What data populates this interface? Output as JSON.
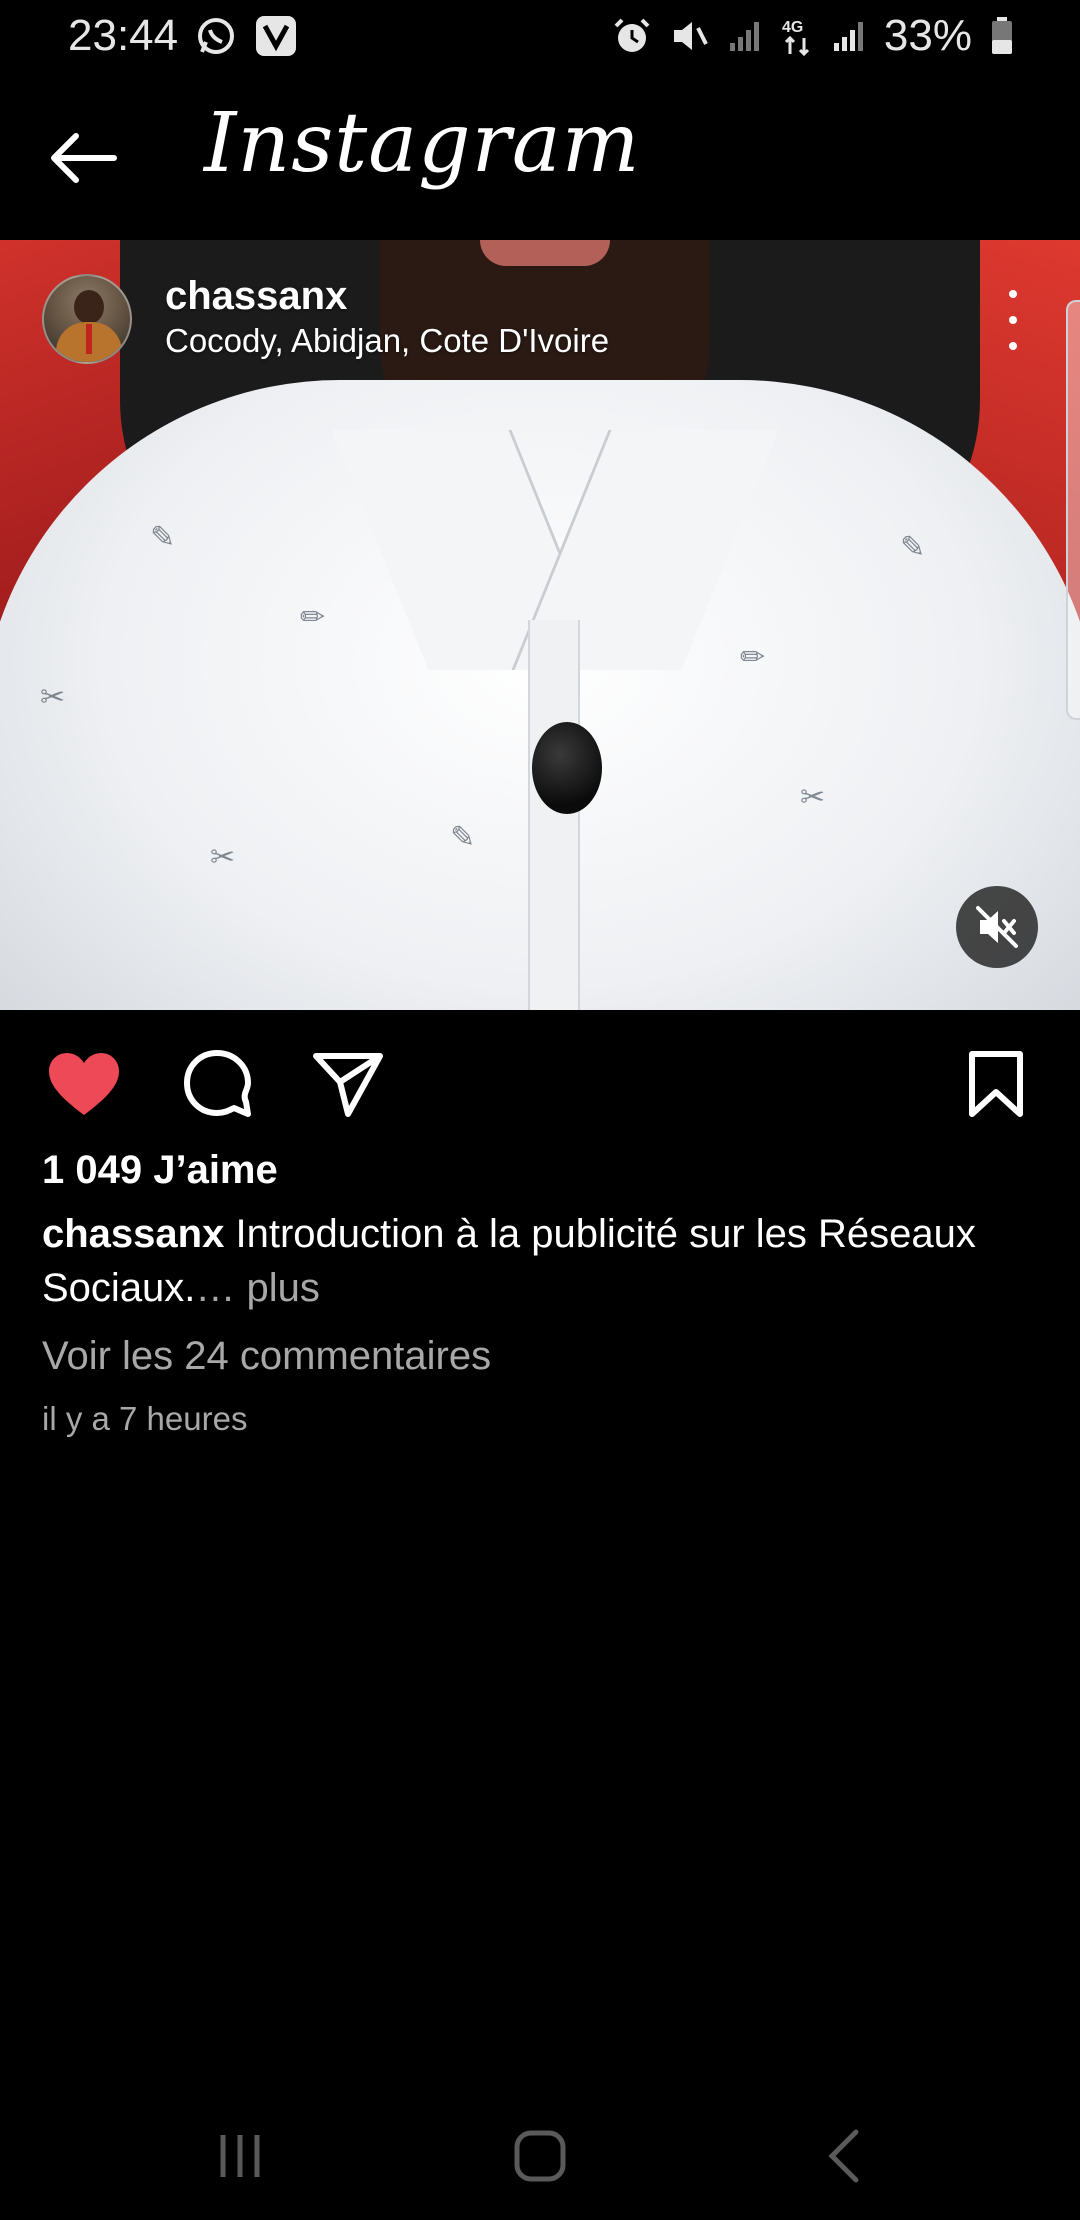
{
  "status_bar": {
    "time": "23:44",
    "network": "4G",
    "battery": "33%",
    "icons": [
      "whatsapp-icon",
      "viber-icon",
      "alarm-icon",
      "mute-vibrate-icon",
      "signal-icon",
      "network-4g-icon",
      "signal-icon",
      "battery-icon"
    ]
  },
  "header": {
    "title": "Instagram",
    "back_icon": "arrow-left-icon"
  },
  "post": {
    "username": "chassanx",
    "location": "Cocody, Abidjan, Cote D'Ivoire",
    "more_icon": "more-vertical-icon",
    "media": {
      "type": "video",
      "muted": true,
      "mute_icon": "volume-off-icon"
    },
    "actions": {
      "like_icon": "heart-filled-icon",
      "like_color": "#ed4956",
      "comment_icon": "comment-icon",
      "share_icon": "send-icon",
      "save_icon": "bookmark-icon"
    },
    "likes": "1 049 J’aime",
    "caption_user": "chassanx",
    "caption_text": "Introduction à la publicité sur les Réseaux Sociaux.",
    "caption_more": "… plus",
    "comments_link": "Voir les 24 commentaires",
    "timestamp": "il y a 7 heures"
  },
  "nav_bar": {
    "recents_icon": "recents-icon",
    "home_icon": "home-icon",
    "back_icon": "nav-back-icon"
  }
}
